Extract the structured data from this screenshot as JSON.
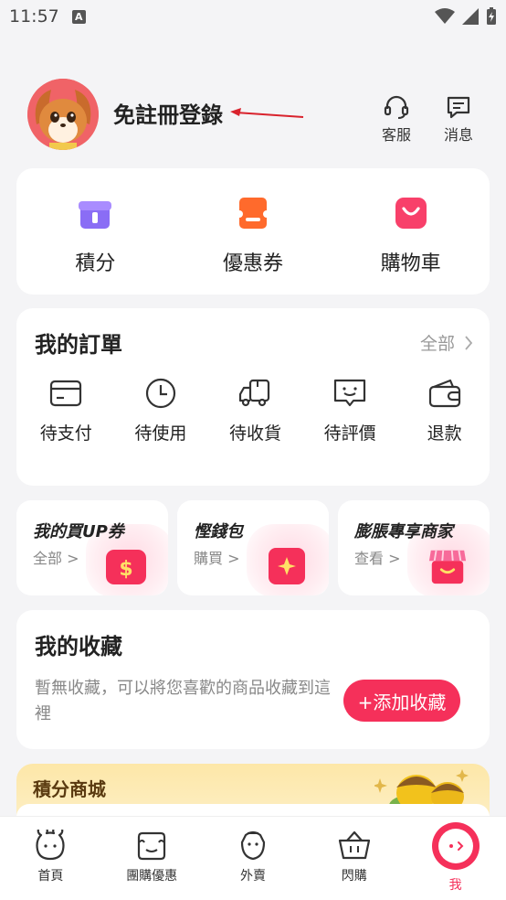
{
  "status_bar": {
    "time": "11:57",
    "notif_icon": "A"
  },
  "header": {
    "login_text": "免註冊登錄",
    "service_label": "客服",
    "message_label": "消息"
  },
  "quick": [
    {
      "label": "積分",
      "color": "#8a6df5",
      "icon": "gift-icon"
    },
    {
      "label": "優惠券",
      "color": "#ff6a2c",
      "icon": "coupon-icon"
    },
    {
      "label": "購物車",
      "color": "#f8406a",
      "icon": "cart-bag-icon"
    }
  ],
  "orders": {
    "title": "我的訂單",
    "all_label": "全部",
    "items": [
      {
        "label": "待支付",
        "icon": "card-icon"
      },
      {
        "label": "待使用",
        "icon": "clock-icon"
      },
      {
        "label": "待收貨",
        "icon": "truck-icon"
      },
      {
        "label": "待評價",
        "icon": "review-icon"
      },
      {
        "label": "退款",
        "icon": "wallet-icon"
      }
    ]
  },
  "promos": [
    {
      "title": "我的買UP券",
      "sub": "全部",
      "color": "#f5305a"
    },
    {
      "title": "慳錢包",
      "sub": "購買",
      "color": "#f5305a"
    },
    {
      "title": "膨脹專享商家",
      "sub": "查看",
      "color": "#f76a9a"
    }
  ],
  "favorites": {
    "title": "我的收藏",
    "desc": "暫無收藏，可以將您喜歡的商品收藏到這裡",
    "button": "+添加收藏"
  },
  "points_mall": {
    "title": "積分商城"
  },
  "tabbar": [
    {
      "label": "首頁",
      "icon": "home-bear-icon",
      "active": false
    },
    {
      "label": "團購優惠",
      "icon": "group-buy-icon",
      "active": false
    },
    {
      "label": "外賣",
      "icon": "takeaway-icon",
      "active": false
    },
    {
      "label": "閃購",
      "icon": "basket-icon",
      "active": false
    },
    {
      "label": "我",
      "icon": "me-icon",
      "active": true
    }
  ],
  "colors": {
    "accent": "#f5305a",
    "background": "#f4f4f6"
  }
}
